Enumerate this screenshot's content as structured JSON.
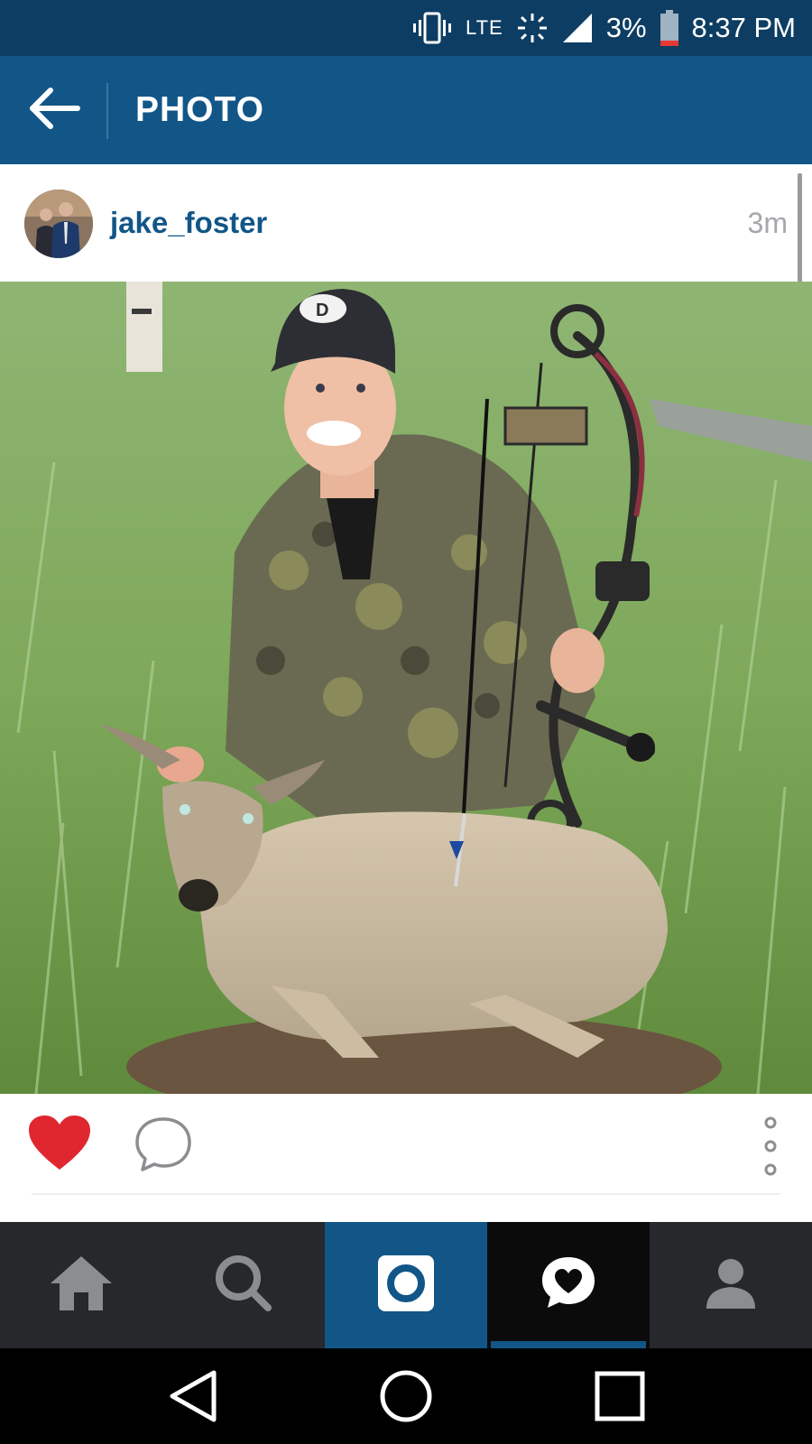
{
  "status_bar": {
    "network": "LTE",
    "battery": "3%",
    "time": "8:37 PM",
    "icons": [
      "vibrate-icon",
      "data-transfer-icon",
      "signal-icon",
      "battery-icon"
    ]
  },
  "app_bar": {
    "title": "PHOTO",
    "back_icon": "arrow-left-icon"
  },
  "post": {
    "username": "jake_foster",
    "time_ago": "3m",
    "photo": "hunter-with-bow-and-deer",
    "liked": true
  },
  "actions": {
    "icons": [
      "heart-icon",
      "comment-icon",
      "more-vertical-icon"
    ]
  },
  "bottom_nav": {
    "items": [
      {
        "icon": "home-icon",
        "selected": false
      },
      {
        "icon": "search-icon",
        "selected": false
      },
      {
        "icon": "camera-icon",
        "selected": false
      },
      {
        "icon": "activity-heart-icon",
        "selected": true
      },
      {
        "icon": "profile-icon",
        "selected": false
      }
    ]
  },
  "system_nav": {
    "icons": [
      "back-triangle-icon",
      "home-circle-icon",
      "recents-square-icon"
    ]
  },
  "colors": {
    "status_bar": "#0d3d63",
    "app_bar": "#125688",
    "username": "#125688",
    "like_red": "#e0262f",
    "nav_bg": "#27282b"
  }
}
